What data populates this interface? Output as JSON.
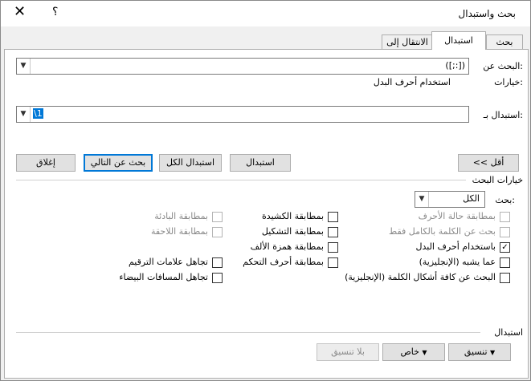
{
  "window": {
    "title": "بحث واستبدال",
    "help": "؟",
    "close": "✕"
  },
  "tabs": [
    "بحث",
    "استبدال",
    "الانتقال إلى"
  ],
  "search": {
    "label": "البحث عن:",
    "value": "([;:])"
  },
  "options": {
    "label": "خيارات:",
    "value": "استخدام أحرف البدل"
  },
  "replace": {
    "label": "استبدال بـ:",
    "value": "\\1"
  },
  "buttons": {
    "less": "<< أقل",
    "replace": "استبدال",
    "replace_all": "استبدال الكل",
    "find_next": "بحث عن التالي",
    "close": "إغلاق"
  },
  "search_options": {
    "title": "خيارات البحث",
    "search_label": "بحث:",
    "search_value": "الكل"
  },
  "checkboxes": {
    "match_case": "بمطابقة حالة الأحرف",
    "whole_words": "بحث عن الكلمة بالكامل فقط",
    "wildcards": "باستخدام أحرف البدل",
    "sounds_like": "عما يشبه (الإنجليزية)",
    "all_word_forms": "البحث عن كافة أشكال الكلمة (الإنجليزية)",
    "kashida": "بمطابقة الكشيدة",
    "diacritics": "بمطابقة التشكيل",
    "alef_hamza": "بمطابقة همزة الألف",
    "control": "بمطابقة أحرف التحكم",
    "prefix": "بمطابقة البادئة",
    "suffix": "بمطابقة اللاحقة",
    "punctuation": "تجاهل علامات الترقيم",
    "whitespace": "تجاهل المسافات البيضاء"
  },
  "replace_section": {
    "title": "استبدال",
    "format": "تنسيق",
    "special": "خاص",
    "no_formatting": "بلا تنسيق"
  },
  "glyphs": {
    "dropdown": "▼",
    "check": "✓"
  }
}
